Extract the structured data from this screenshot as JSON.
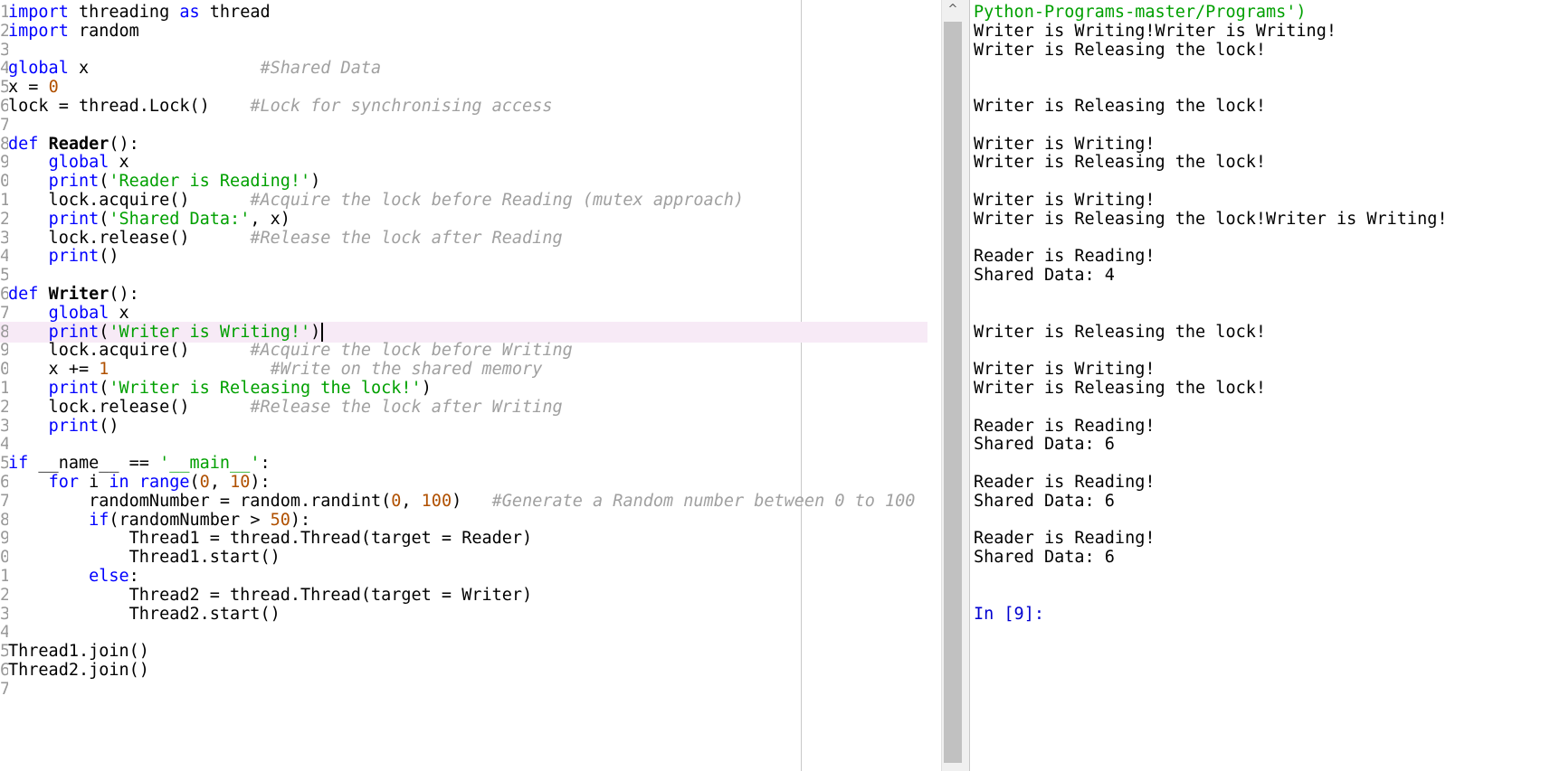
{
  "editor": {
    "gutter_numbers": [
      "1",
      "2",
      "3",
      "4",
      "5",
      "6",
      "7",
      "8",
      "9",
      "0",
      "1",
      "2",
      "3",
      "4",
      "5",
      "6",
      "7",
      "8",
      "9",
      "0",
      "1",
      "2",
      "3",
      "4",
      "5",
      "6",
      "7",
      "8",
      "9",
      "0",
      "1",
      "2",
      "3",
      "4",
      "5",
      "6",
      "7"
    ],
    "lines": [
      [
        [
          "kw",
          "import"
        ],
        [
          "p",
          " threading "
        ],
        [
          "kw",
          "as"
        ],
        [
          "p",
          " thread"
        ]
      ],
      [
        [
          "kw",
          "import"
        ],
        [
          "p",
          " random"
        ]
      ],
      [],
      [
        [
          "kw",
          "global"
        ],
        [
          "p",
          " x                 "
        ],
        [
          "cmt",
          "#Shared Data"
        ]
      ],
      [
        [
          "p",
          "x = "
        ],
        [
          "num",
          "0"
        ]
      ],
      [
        [
          "p",
          "lock = thread.Lock()    "
        ],
        [
          "cmt",
          "#Lock for synchronising access"
        ]
      ],
      [],
      [
        [
          "kw",
          "def"
        ],
        [
          "p",
          " "
        ],
        [
          "name",
          "Reader"
        ],
        [
          "p",
          "():"
        ]
      ],
      [
        [
          "p",
          "    "
        ],
        [
          "kw",
          "global"
        ],
        [
          "p",
          " x"
        ]
      ],
      [
        [
          "p",
          "    "
        ],
        [
          "kw",
          "print"
        ],
        [
          "p",
          "("
        ],
        [
          "str",
          "'Reader is Reading!'"
        ],
        [
          "p",
          ")"
        ]
      ],
      [
        [
          "p",
          "    lock.acquire()      "
        ],
        [
          "cmt",
          "#Acquire the lock before Reading (mutex approach)"
        ]
      ],
      [
        [
          "p",
          "    "
        ],
        [
          "kw",
          "print"
        ],
        [
          "p",
          "("
        ],
        [
          "str",
          "'Shared Data:'"
        ],
        [
          "p",
          ", x)"
        ]
      ],
      [
        [
          "p",
          "    lock.release()      "
        ],
        [
          "cmt",
          "#Release the lock after Reading"
        ]
      ],
      [
        [
          "p",
          "    "
        ],
        [
          "kw",
          "print"
        ],
        [
          "p",
          "()"
        ]
      ],
      [],
      [
        [
          "kw",
          "def"
        ],
        [
          "p",
          " "
        ],
        [
          "name",
          "Writer"
        ],
        [
          "p",
          "():"
        ]
      ],
      [
        [
          "p",
          "    "
        ],
        [
          "kw",
          "global"
        ],
        [
          "p",
          " x"
        ]
      ],
      [
        [
          "p",
          "    "
        ],
        [
          "kw",
          "print"
        ],
        [
          "p",
          "("
        ],
        [
          "str",
          "'Writer is Writing!'"
        ],
        [
          "p",
          ")"
        ],
        [
          "caret",
          ""
        ]
      ],
      [
        [
          "p",
          "    lock.acquire()      "
        ],
        [
          "cmt",
          "#Acquire the lock before Writing"
        ]
      ],
      [
        [
          "p",
          "    x += "
        ],
        [
          "num",
          "1"
        ],
        [
          "p",
          "                "
        ],
        [
          "cmt",
          "#Write on the shared memory"
        ]
      ],
      [
        [
          "p",
          "    "
        ],
        [
          "kw",
          "print"
        ],
        [
          "p",
          "("
        ],
        [
          "str",
          "'Writer is Releasing the lock!'"
        ],
        [
          "p",
          ")"
        ]
      ],
      [
        [
          "p",
          "    lock.release()      "
        ],
        [
          "cmt",
          "#Release the lock after Writing"
        ]
      ],
      [
        [
          "p",
          "    "
        ],
        [
          "kw",
          "print"
        ],
        [
          "p",
          "()"
        ]
      ],
      [],
      [
        [
          "kw",
          "if"
        ],
        [
          "p",
          " __name__ == "
        ],
        [
          "str",
          "'__main__'"
        ],
        [
          "p",
          ":"
        ]
      ],
      [
        [
          "p",
          "    "
        ],
        [
          "kw",
          "for"
        ],
        [
          "p",
          " i "
        ],
        [
          "kw",
          "in"
        ],
        [
          "p",
          " "
        ],
        [
          "kw",
          "range"
        ],
        [
          "p",
          "("
        ],
        [
          "num",
          "0"
        ],
        [
          "p",
          ", "
        ],
        [
          "num",
          "10"
        ],
        [
          "p",
          "):"
        ]
      ],
      [
        [
          "p",
          "        randomNumber = random.randint("
        ],
        [
          "num",
          "0"
        ],
        [
          "p",
          ", "
        ],
        [
          "num",
          "100"
        ],
        [
          "p",
          ")   "
        ],
        [
          "cmt",
          "#Generate a Random number between 0 to 100"
        ]
      ],
      [
        [
          "p",
          "        "
        ],
        [
          "kw",
          "if"
        ],
        [
          "p",
          "(randomNumber > "
        ],
        [
          "num",
          "50"
        ],
        [
          "p",
          "):"
        ]
      ],
      [
        [
          "p",
          "            Thread1 = thread.Thread(target = Reader)"
        ]
      ],
      [
        [
          "p",
          "            Thread1.start()"
        ]
      ],
      [
        [
          "p",
          "        "
        ],
        [
          "kw",
          "else"
        ],
        [
          "p",
          ":"
        ]
      ],
      [
        [
          "p",
          "            Thread2 = thread.Thread(target = Writer)"
        ]
      ],
      [
        [
          "p",
          "            Thread2.start()"
        ]
      ],
      [],
      [
        [
          "p",
          "Thread1.join()"
        ]
      ],
      [
        [
          "p",
          "Thread2.join()"
        ]
      ],
      []
    ]
  },
  "console": {
    "lines": [
      "Python-Programs-master/Programs')",
      "Writer is Writing!Writer is Writing!",
      "Writer is Releasing the lock!",
      "",
      "",
      "Writer is Releasing the lock!",
      "",
      "Writer is Writing!",
      "Writer is Releasing the lock!",
      "",
      "Writer is Writing!",
      "Writer is Releasing the lock!Writer is Writing!",
      "",
      "Reader is Reading!",
      "Shared Data: 4",
      "",
      "",
      "Writer is Releasing the lock!",
      "",
      "Writer is Writing!",
      "Writer is Releasing the lock!",
      "",
      "Reader is Reading!",
      "Shared Data: 6",
      "",
      "Reader is Reading!",
      "Shared Data: 6",
      "",
      "Reader is Reading!",
      "Shared Data: 6",
      "",
      "",
      "In [9]:"
    ]
  },
  "scrollbar": {
    "up_glyph": "^"
  },
  "colors": {
    "keyword": "#0000ff",
    "string": "#00a000",
    "number": "#b05000",
    "comment": "#a0a0a0",
    "prompt": "#0000d0",
    "current_line": "#f7eaf6"
  }
}
